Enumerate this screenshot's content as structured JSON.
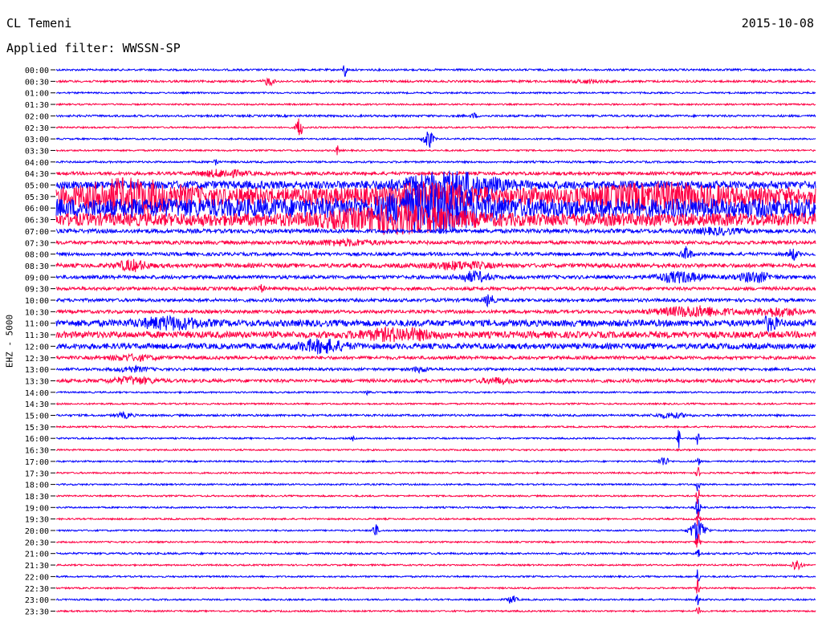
{
  "header": {
    "station": "CL Temeni",
    "date": "2015-10-08",
    "filter": "Applied filter: WWSSN-SP"
  },
  "chart_data": {
    "type": "line",
    "title": "CL Temeni",
    "ylabel": "EHZ - 5000",
    "colors": [
      "#0000ff",
      "#ff0044"
    ],
    "rows": [
      {
        "time": "00:00",
        "color": "#0000ff",
        "noise": 1.2,
        "events": [
          {
            "x": 0.38,
            "amp": 12,
            "w": 0.002
          }
        ]
      },
      {
        "time": "00:30",
        "color": "#ff0044",
        "noise": 1.3,
        "events": [
          {
            "x": 0.28,
            "amp": 5,
            "w": 0.006
          },
          {
            "x": 0.7,
            "amp": 2,
            "w": 0.02
          }
        ]
      },
      {
        "time": "01:00",
        "color": "#0000ff",
        "noise": 1.0,
        "events": []
      },
      {
        "time": "01:30",
        "color": "#ff0044",
        "noise": 1.0,
        "events": []
      },
      {
        "time": "02:00",
        "color": "#0000ff",
        "noise": 1.3,
        "events": [
          {
            "x": 0.55,
            "amp": 3,
            "w": 0.004
          }
        ]
      },
      {
        "time": "02:30",
        "color": "#ff0044",
        "noise": 1.0,
        "events": [
          {
            "x": 0.32,
            "amp": 14,
            "w": 0.004
          }
        ]
      },
      {
        "time": "03:00",
        "color": "#0000ff",
        "noise": 1.0,
        "events": [
          {
            "x": 0.49,
            "amp": 12,
            "w": 0.006
          }
        ]
      },
      {
        "time": "03:30",
        "color": "#ff0044",
        "noise": 1.0,
        "events": [
          {
            "x": 0.37,
            "amp": 6,
            "w": 0.002
          }
        ]
      },
      {
        "time": "04:00",
        "color": "#0000ff",
        "noise": 1.2,
        "events": [
          {
            "x": 0.21,
            "amp": 8,
            "w": 0.002
          }
        ]
      },
      {
        "time": "04:30",
        "color": "#ff0044",
        "noise": 2.0,
        "events": [
          {
            "x": 0.22,
            "amp": 4,
            "w": 0.03
          }
        ]
      },
      {
        "time": "05:00",
        "color": "#0000ff",
        "noise": 5.0,
        "events": [
          {
            "x": 0.52,
            "amp": 14,
            "w": 0.06
          }
        ]
      },
      {
        "time": "05:30",
        "color": "#ff0044",
        "noise": 11.0,
        "events": [
          {
            "x": 0.1,
            "amp": 14,
            "w": 0.06
          },
          {
            "x": 0.5,
            "amp": 10,
            "w": 0.05
          },
          {
            "x": 0.8,
            "amp": 8,
            "w": 0.08
          }
        ]
      },
      {
        "time": "06:00",
        "color": "#0000ff",
        "noise": 12.0,
        "events": [
          {
            "x": 0.5,
            "amp": 22,
            "w": 0.06
          }
        ]
      },
      {
        "time": "06:30",
        "color": "#ff0044",
        "noise": 8.0,
        "events": [
          {
            "x": 0.45,
            "amp": 12,
            "w": 0.08
          }
        ]
      },
      {
        "time": "07:00",
        "color": "#0000ff",
        "noise": 2.5,
        "events": [
          {
            "x": 0.87,
            "amp": 3,
            "w": 0.03
          }
        ]
      },
      {
        "time": "07:30",
        "color": "#ff0044",
        "noise": 2.2,
        "events": [
          {
            "x": 0.38,
            "amp": 3,
            "w": 0.04
          }
        ]
      },
      {
        "time": "08:00",
        "color": "#0000ff",
        "noise": 2.0,
        "events": [
          {
            "x": 0.83,
            "amp": 8,
            "w": 0.006
          },
          {
            "x": 0.97,
            "amp": 7,
            "w": 0.006
          }
        ]
      },
      {
        "time": "08:30",
        "color": "#ff0044",
        "noise": 2.5,
        "events": [
          {
            "x": 0.1,
            "amp": 6,
            "w": 0.02
          },
          {
            "x": 0.53,
            "amp": 4,
            "w": 0.04
          }
        ]
      },
      {
        "time": "09:00",
        "color": "#0000ff",
        "noise": 2.2,
        "events": [
          {
            "x": 0.55,
            "amp": 6,
            "w": 0.02
          },
          {
            "x": 0.82,
            "amp": 6,
            "w": 0.03
          },
          {
            "x": 0.92,
            "amp": 6,
            "w": 0.02
          }
        ]
      },
      {
        "time": "09:30",
        "color": "#ff0044",
        "noise": 2.0,
        "events": [
          {
            "x": 0.27,
            "amp": 4,
            "w": 0.004
          }
        ]
      },
      {
        "time": "10:00",
        "color": "#0000ff",
        "noise": 2.0,
        "events": [
          {
            "x": 0.57,
            "amp": 7,
            "w": 0.006
          }
        ]
      },
      {
        "time": "10:30",
        "color": "#ff0044",
        "noise": 2.0,
        "events": [
          {
            "x": 0.84,
            "amp": 6,
            "w": 0.05
          },
          {
            "x": 0.95,
            "amp": 5,
            "w": 0.03
          }
        ]
      },
      {
        "time": "11:00",
        "color": "#0000ff",
        "noise": 4.0,
        "events": [
          {
            "x": 0.15,
            "amp": 6,
            "w": 0.04
          },
          {
            "x": 0.94,
            "amp": 7,
            "w": 0.01
          }
        ]
      },
      {
        "time": "11:30",
        "color": "#ff0044",
        "noise": 4.0,
        "events": [
          {
            "x": 0.45,
            "amp": 6,
            "w": 0.05
          }
        ]
      },
      {
        "time": "12:00",
        "color": "#0000ff",
        "noise": 3.5,
        "events": [
          {
            "x": 0.35,
            "amp": 7,
            "w": 0.03
          }
        ]
      },
      {
        "time": "12:30",
        "color": "#ff0044",
        "noise": 2.0,
        "events": [
          {
            "x": 0.1,
            "amp": 3,
            "w": 0.03
          }
        ]
      },
      {
        "time": "13:00",
        "color": "#0000ff",
        "noise": 1.6,
        "events": [
          {
            "x": 0.1,
            "amp": 3,
            "w": 0.02
          },
          {
            "x": 0.48,
            "amp": 3,
            "w": 0.01
          }
        ]
      },
      {
        "time": "13:30",
        "color": "#ff0044",
        "noise": 2.0,
        "events": [
          {
            "x": 0.1,
            "amp": 4,
            "w": 0.03
          },
          {
            "x": 0.58,
            "amp": 3,
            "w": 0.02
          }
        ]
      },
      {
        "time": "14:00",
        "color": "#0000ff",
        "noise": 1.0,
        "events": [
          {
            "x": 0.41,
            "amp": 3,
            "w": 0.002
          }
        ]
      },
      {
        "time": "14:30",
        "color": "#ff0044",
        "noise": 1.0,
        "events": []
      },
      {
        "time": "15:00",
        "color": "#0000ff",
        "noise": 1.3,
        "events": [
          {
            "x": 0.09,
            "amp": 3,
            "w": 0.01
          },
          {
            "x": 0.81,
            "amp": 3,
            "w": 0.02
          }
        ]
      },
      {
        "time": "15:30",
        "color": "#ff0044",
        "noise": 1.0,
        "events": []
      },
      {
        "time": "16:00",
        "color": "#0000ff",
        "noise": 1.0,
        "events": [
          {
            "x": 0.39,
            "amp": 3,
            "w": 0.002
          },
          {
            "x": 0.82,
            "amp": 12,
            "w": 0.002
          },
          {
            "x": 0.845,
            "amp": 14,
            "w": 0.002
          }
        ]
      },
      {
        "time": "16:30",
        "color": "#ff0044",
        "noise": 1.0,
        "events": []
      },
      {
        "time": "17:00",
        "color": "#0000ff",
        "noise": 1.0,
        "events": [
          {
            "x": 0.8,
            "amp": 6,
            "w": 0.006
          },
          {
            "x": 0.845,
            "amp": 10,
            "w": 0.002
          }
        ]
      },
      {
        "time": "17:30",
        "color": "#ff0044",
        "noise": 1.0,
        "events": [
          {
            "x": 0.845,
            "amp": 8,
            "w": 0.002
          }
        ]
      },
      {
        "time": "18:00",
        "color": "#0000ff",
        "noise": 1.0,
        "events": [
          {
            "x": 0.845,
            "amp": 10,
            "w": 0.002
          }
        ]
      },
      {
        "time": "18:30",
        "color": "#ff0044",
        "noise": 1.0,
        "events": [
          {
            "x": 0.845,
            "amp": 12,
            "w": 0.002
          }
        ]
      },
      {
        "time": "19:00",
        "color": "#0000ff",
        "noise": 1.0,
        "events": [
          {
            "x": 0.845,
            "amp": 14,
            "w": 0.003
          }
        ]
      },
      {
        "time": "19:30",
        "color": "#ff0044",
        "noise": 1.0,
        "events": [
          {
            "x": 0.845,
            "amp": 10,
            "w": 0.003
          }
        ]
      },
      {
        "time": "20:00",
        "color": "#0000ff",
        "noise": 1.0,
        "events": [
          {
            "x": 0.42,
            "amp": 8,
            "w": 0.004
          },
          {
            "x": 0.845,
            "amp": 14,
            "w": 0.01
          }
        ]
      },
      {
        "time": "20:30",
        "color": "#ff0044",
        "noise": 1.0,
        "events": [
          {
            "x": 0.845,
            "amp": 10,
            "w": 0.003
          }
        ]
      },
      {
        "time": "21:00",
        "color": "#0000ff",
        "noise": 1.2,
        "events": [
          {
            "x": 0.845,
            "amp": 10,
            "w": 0.002
          }
        ]
      },
      {
        "time": "21:30",
        "color": "#ff0044",
        "noise": 1.0,
        "events": [
          {
            "x": 0.975,
            "amp": 8,
            "w": 0.006
          }
        ]
      },
      {
        "time": "22:00",
        "color": "#0000ff",
        "noise": 1.0,
        "events": [
          {
            "x": 0.845,
            "amp": 10,
            "w": 0.002
          }
        ]
      },
      {
        "time": "22:30",
        "color": "#ff0044",
        "noise": 1.0,
        "events": [
          {
            "x": 0.845,
            "amp": 10,
            "w": 0.002
          }
        ]
      },
      {
        "time": "23:00",
        "color": "#0000ff",
        "noise": 1.0,
        "events": [
          {
            "x": 0.6,
            "amp": 5,
            "w": 0.006
          },
          {
            "x": 0.845,
            "amp": 10,
            "w": 0.002
          }
        ]
      },
      {
        "time": "23:30",
        "color": "#ff0044",
        "noise": 1.0,
        "events": [
          {
            "x": 0.845,
            "amp": 10,
            "w": 0.002
          }
        ]
      }
    ]
  }
}
